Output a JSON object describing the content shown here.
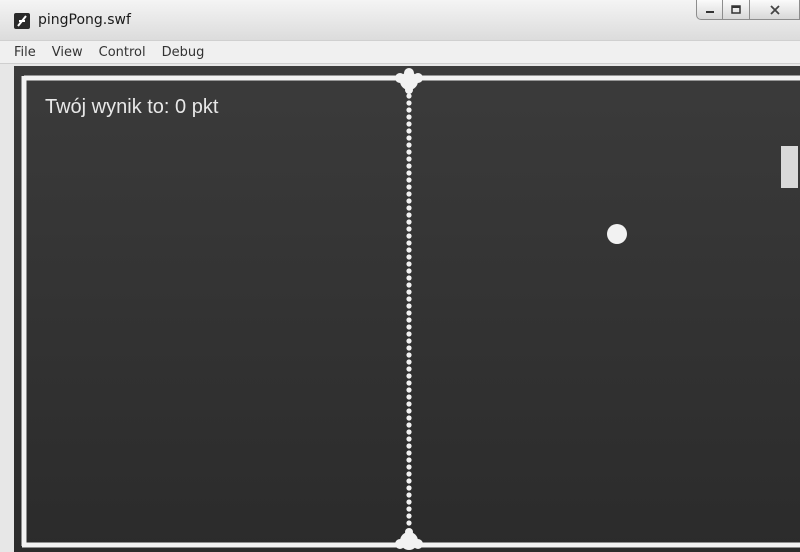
{
  "window": {
    "title": "pingPong.swf"
  },
  "menu": {
    "items": [
      "File",
      "View",
      "Control",
      "Debug"
    ]
  },
  "game": {
    "score_text": "Twój wynik to: 0 pkt"
  },
  "icons": {
    "app": "flash-player-icon",
    "minimize": "minimize-icon",
    "maximize": "maximize-icon",
    "close": "close-icon"
  },
  "colors": {
    "field_background": "#333333",
    "field_lines": "#f2f2f2",
    "ball": "#f2f2f2",
    "paddle": "#d9d9d9"
  }
}
